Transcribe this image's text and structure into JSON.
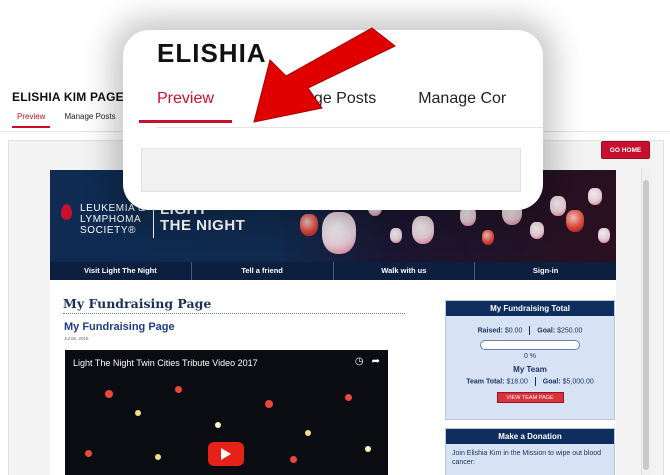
{
  "admin": {
    "page_title": "ELISHIA KIM PAGE",
    "tabs": [
      {
        "label": "Preview",
        "active": true
      },
      {
        "label": "Manage Posts",
        "active": false
      }
    ],
    "go_home_label": "GO HOME"
  },
  "fundraising": {
    "org_name_lines": [
      "LEUKEMIA &",
      "LYMPHOMA",
      "SOCIETY®"
    ],
    "campaign_lines": [
      "LIGHT",
      "THE NIGHT"
    ],
    "nav": [
      "Visit Light The Night",
      "Tell a friend",
      "Walk with us",
      "Sign-in"
    ],
    "heading": "My Fundraising Page",
    "post": {
      "title": "My Fundraising Page",
      "date": "Jul 06, 2018",
      "video_title": "Light The Night Twin Cities Tribute Video 2017"
    },
    "total_box": {
      "title": "My Fundraising Total",
      "raised_label": "Raised:",
      "raised_value": "$0.00",
      "goal_label": "Goal:",
      "goal_value": "$250.00",
      "progress": 0,
      "percent_text": "0 %",
      "team_heading": "My Team",
      "team_total_label": "Team Total:",
      "team_total_value": "$18.00",
      "team_goal_label": "Goal:",
      "team_goal_value": "$5,000.00",
      "team_button": "VIEW TEAM PAGE"
    },
    "donation_box": {
      "title": "Make a Donation",
      "text": "Join Elishia Kim in the Mission to wipe out blood cancer:"
    }
  },
  "zoom": {
    "title": "ELISHIA",
    "tabs": [
      "Preview",
      "Manage Posts",
      "Manage Cor"
    ]
  },
  "colors": {
    "accent_red": "#c8102e",
    "navy": "#0f2d5e",
    "sidebar_bg": "#d7e3f4"
  },
  "icons": [
    "clock-icon",
    "share-icon",
    "play-icon",
    "blood-drop-icon",
    "red-arrow-icon"
  ]
}
